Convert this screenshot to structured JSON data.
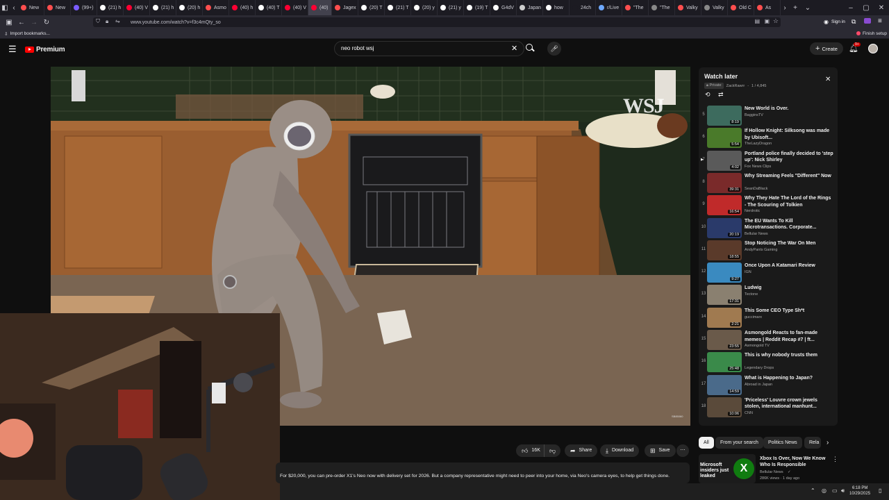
{
  "browser": {
    "tabs": [
      {
        "label": "New",
        "color": "#ff4e4e"
      },
      {
        "label": "New",
        "color": "#ff4e4e"
      },
      {
        "label": "(99+)",
        "color": "#7b5cff"
      },
      {
        "label": "(21) h",
        "color": "#ffffff"
      },
      {
        "label": "(40) V",
        "color": "#ff0033"
      },
      {
        "label": "(21) h",
        "color": "#ffffff"
      },
      {
        "label": "(20) h",
        "color": "#ffffff"
      },
      {
        "label": "Asmo",
        "color": "#ff4e4e"
      },
      {
        "label": "(40) h",
        "color": "#ff0033"
      },
      {
        "label": "(40) T",
        "color": "#ffffff"
      },
      {
        "label": "(40) V",
        "color": "#ff0033"
      },
      {
        "label": "(40)",
        "color": "#ff0033",
        "active": true
      },
      {
        "label": "Jagex",
        "color": "#ff4e4e"
      },
      {
        "label": "(20) T",
        "color": "#ffffff"
      },
      {
        "label": "(21) T",
        "color": "#ffffff"
      },
      {
        "label": "(20) y",
        "color": "#ffffff"
      },
      {
        "label": "(21) y",
        "color": "#ffffff"
      },
      {
        "label": "(19) T",
        "color": "#ffffff"
      },
      {
        "label": "G4dV",
        "color": "#ffffff"
      },
      {
        "label": "Japan",
        "color": "#cccccc"
      },
      {
        "label": "how",
        "color": "#ffffff"
      },
      {
        "label": "24ch",
        "color": "#1c1b22"
      },
      {
        "label": "r/Live",
        "color": "#6ea8fe"
      },
      {
        "label": "\"The",
        "color": "#ff4e4e"
      },
      {
        "label": "\"The",
        "color": "#888888"
      },
      {
        "label": "Valky",
        "color": "#ff4e4e"
      },
      {
        "label": "Valky",
        "color": "#888888"
      },
      {
        "label": "Old C",
        "color": "#ff4e4e"
      },
      {
        "label": "As",
        "color": "#ff4e4e"
      }
    ],
    "url": "www.youtube.com/watch?v=f3c4mQty_so",
    "bookmarks_label": "Import bookmarks...",
    "sign_in": "Sign in",
    "finish_setup": "Finish setup"
  },
  "yt": {
    "logo_text": "Premium",
    "search_value": "neo robot wsj",
    "create_label": "Create",
    "notif_badge": "9+",
    "video_watermark": "WSJ",
    "video_code": "SB85060",
    "actions": {
      "likes": "16K",
      "share": "Share",
      "download": "Download",
      "save": "Save"
    },
    "description": "For $20,000, you can pre-order X1's Neo now with delivery set for 2026. But a company representative might need to peer into your home, via Neo's camera eyes, to help get things done."
  },
  "playlist": {
    "title": "Watch later",
    "privacy": "Private",
    "owner": "ZackRawrr",
    "position": "1 / 4,845",
    "items": [
      {
        "idx": "5",
        "title": "New World is Over.",
        "channel": "BagginsTV",
        "duration": "8:19",
        "thumb": "#3d6b5e"
      },
      {
        "idx": "6",
        "title": "If Hollow Knight: Silksong was made by Ubisoft...",
        "channel": "TheLazyDragon",
        "duration": "5:54",
        "thumb": "#4a7a2a"
      },
      {
        "idx": "7",
        "title": "Portland police finally decided to 'step up': Nick Shirley",
        "channel": "Fox News Clips",
        "duration": "4:02",
        "thumb": "#5a5a5a"
      },
      {
        "idx": "8",
        "title": "Why Streaming Feels \"Different\" Now",
        "channel": "SeanDaBlack",
        "duration": "39:31",
        "thumb": "#7a2a2a"
      },
      {
        "idx": "9",
        "title": "Why They Hate The Lord of the Rings - The Scouring of Tolkien",
        "channel": "Nerdrotic",
        "duration": "16:54",
        "thumb": "#c02a2a"
      },
      {
        "idx": "10",
        "title": "The EU Wants To Kill Microtransactions. Corporate...",
        "channel": "Bellular News",
        "duration": "20:19",
        "thumb": "#2a3a6a"
      },
      {
        "idx": "11",
        "title": "Stop Noticing The War On Men",
        "channel": "AndyPants Gaming",
        "duration": "18:55",
        "thumb": "#5a3a2a"
      },
      {
        "idx": "12",
        "title": "Once Upon A Katamari Review",
        "channel": "IGN",
        "duration": "9:27",
        "thumb": "#3a8ac0"
      },
      {
        "idx": "13",
        "title": "Ludwig",
        "channel": "Tectone",
        "duration": "17:31",
        "thumb": "#8a8070"
      },
      {
        "idx": "14",
        "title": "This Some CEO Type Sh*t",
        "channel": "guccimarx",
        "duration": "2:21",
        "thumb": "#a07a50"
      },
      {
        "idx": "15",
        "title": "Asmongold Reacts to fan-made memes | Reddit Recap #7 | ft...",
        "channel": "Asmongold TV",
        "duration": "23:55",
        "thumb": "#6a5a4a"
      },
      {
        "idx": "16",
        "title": "This is why nobody trusts them",
        "channel": "Legendary Drops",
        "duration": "25:48",
        "thumb": "#3a8a4a"
      },
      {
        "idx": "17",
        "title": "What is Happening to Japan?",
        "channel": "Abroad in Japan",
        "duration": "14:59",
        "thumb": "#4a6a8a"
      },
      {
        "idx": "18",
        "title": "'Priceless' Louvre crown jewels stolen, international manhunt...",
        "channel": "CNN",
        "duration": "10:06",
        "thumb": "#5a4a3a"
      }
    ]
  },
  "chips": [
    "All",
    "From your search",
    "Politics News",
    "Rela"
  ],
  "rec": {
    "title": "Xbox Is Over, Now We Know Who Is Responsible",
    "channel": "Bellular News",
    "meta": "286K views · 1 day ago",
    "thumb_text": "Microsoft insiders just leaked"
  },
  "taskbar": {
    "time": "6:18 PM",
    "date": "10/29/2025"
  }
}
